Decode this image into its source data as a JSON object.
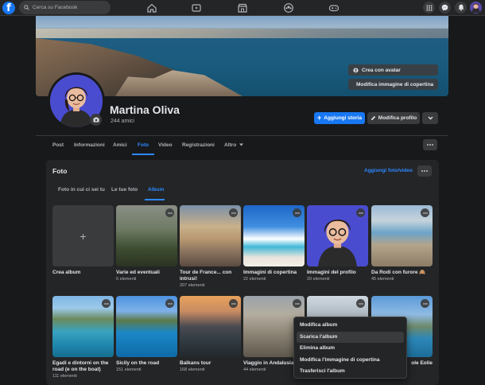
{
  "topbar": {
    "search_placeholder": "Cerca su Facebook",
    "logo": "f"
  },
  "cover": {
    "create_avatar_label": "Crea con avatar",
    "edit_cover_label": "Modifica immagine di copertina"
  },
  "profile": {
    "name": "Martina Oliva",
    "friends": "244 amici",
    "add_story_label": "Aggiungi storia",
    "edit_profile_label": "Modifica profilo"
  },
  "tabs": [
    {
      "label": "Post"
    },
    {
      "label": "Informazioni"
    },
    {
      "label": "Amici"
    },
    {
      "label": "Foto"
    },
    {
      "label": "Video"
    },
    {
      "label": "Registrazioni"
    },
    {
      "label": "Altro"
    }
  ],
  "photos": {
    "title": "Foto",
    "add_link": "Aggiungi foto/video",
    "subtabs": [
      {
        "label": "Foto in cui ci sei tu"
      },
      {
        "label": "Le tue foto"
      },
      {
        "label": "Album"
      }
    ],
    "albums": [
      {
        "name": "Crea album",
        "count": ""
      },
      {
        "name": "Varie ed eventuali",
        "count": "6 elementi"
      },
      {
        "name": "Tour de France... con intrusi!",
        "count": "207 elementi"
      },
      {
        "name": "Immagini di copertina",
        "count": "22 elementi"
      },
      {
        "name": "Immagini del profilo",
        "count": "20 elementi"
      },
      {
        "name": "Da Rodi con furore 🙈",
        "count": "45 elementi"
      },
      {
        "name": "Egadi e dintorni on the road (e on the boat)",
        "count": "111 elementi"
      },
      {
        "name": "Sicily on the road",
        "count": "151 elementi"
      },
      {
        "name": "Balkans tour",
        "count": "168 elementi"
      },
      {
        "name": "Viaggio in Andalusia",
        "count": "44 elementi"
      },
      {
        "name": "",
        "count": ""
      },
      {
        "name": "ole Eolie",
        "count": ""
      }
    ]
  },
  "context_menu": {
    "items": [
      {
        "label": "Modifica album"
      },
      {
        "label": "Scarica l'album"
      },
      {
        "label": "Elimina album"
      },
      {
        "label": "Modifica l'immagine di copertina"
      },
      {
        "label": "Trasferisci l'album"
      }
    ]
  },
  "colors": {
    "accent": "#2d88ff",
    "primary_button": "#1877f2",
    "background": "#18191a",
    "card": "#242526"
  }
}
